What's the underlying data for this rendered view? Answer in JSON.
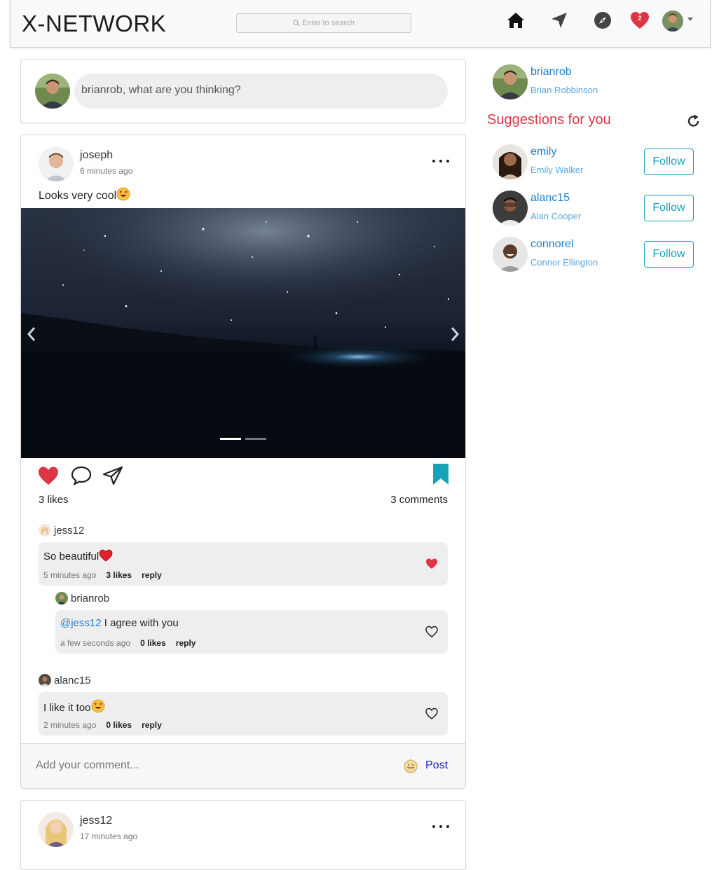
{
  "app": {
    "brand": "X-NETWORK"
  },
  "search": {
    "placeholder": "Enter to search"
  },
  "nav": {
    "icons": [
      "home-icon",
      "send-icon",
      "compass-icon",
      "heart-icon"
    ],
    "notification_count": "2",
    "accent": "#dc3545"
  },
  "composer": {
    "prompt": "brianrob, what are you thinking?"
  },
  "post": {
    "username": "joseph",
    "time": "6 minutes ago",
    "caption": "Looks very cool",
    "likes": "3 likes",
    "comments_count": "3 comments",
    "saved_color": "#17a2b8",
    "slides": 2,
    "active_slide": 1,
    "comments": [
      {
        "user": "jess12",
        "text": "So beautiful",
        "time": "5 minutes ago",
        "likes": "3 likes",
        "reply": "reply",
        "liked": true
      },
      {
        "user": "brianrob",
        "mention": "@jess12",
        "text": " I agree with you",
        "time": "a few seconds ago",
        "likes": "0 likes",
        "reply": "reply",
        "liked": false
      },
      {
        "user": "alanc15",
        "text": "I like it too",
        "time": "2 minutes ago",
        "likes": "0 likes",
        "reply": "reply",
        "liked": false
      }
    ],
    "add_comment_placeholder": "Add your comment...",
    "post_button": "Post"
  },
  "post2": {
    "username": "jess12",
    "time": "17 minutes ago"
  },
  "sidebar": {
    "me": {
      "username": "brianrob",
      "full_name": "Brian Robbinson"
    },
    "suggestions_title": "Suggestions for you",
    "suggestions": [
      {
        "username": "emily",
        "full_name": "Emily Walker",
        "button": "Follow"
      },
      {
        "username": "alanc15",
        "full_name": "Alan Cooper",
        "button": "Follow"
      },
      {
        "username": "connorel",
        "full_name": "Connor Ellington",
        "button": "Follow"
      }
    ]
  }
}
